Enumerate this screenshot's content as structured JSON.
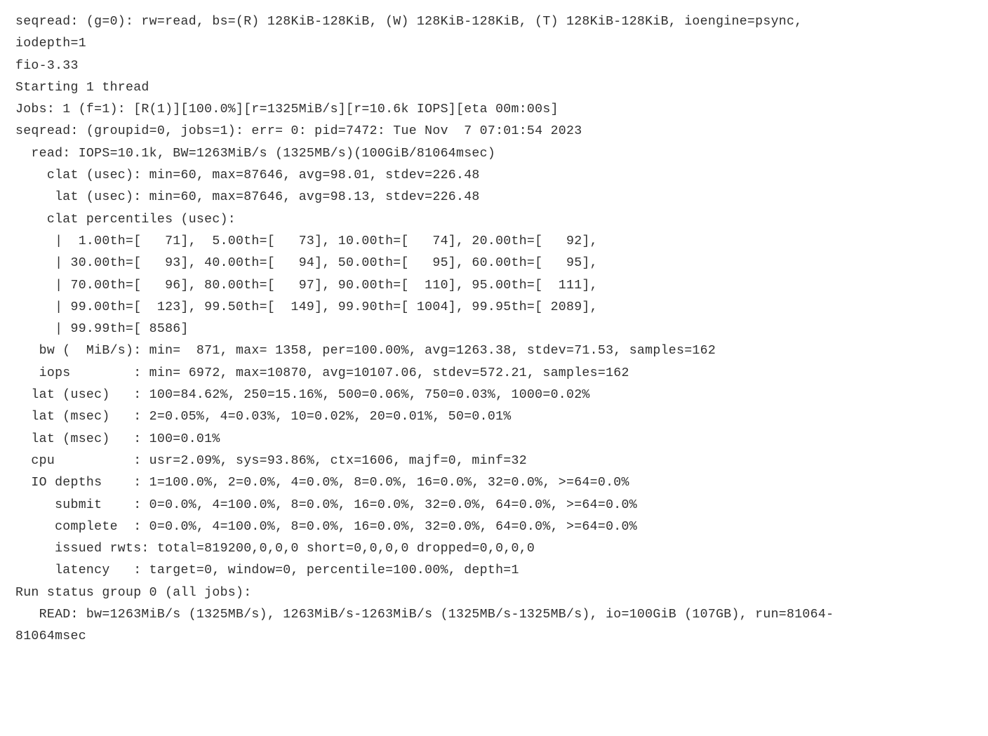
{
  "lines": {
    "l0": "seqread: (g=0): rw=read, bs=(R) 128KiB-128KiB, (W) 128KiB-128KiB, (T) 128KiB-128KiB, ioengine=psync,",
    "l1": "iodepth=1",
    "l2": "fio-3.33",
    "l3": "Starting 1 thread",
    "l4": "Jobs: 1 (f=1): [R(1)][100.0%][r=1325MiB/s][r=10.6k IOPS][eta 00m:00s]",
    "l5": "seqread: (groupid=0, jobs=1): err= 0: pid=7472: Tue Nov  7 07:01:54 2023",
    "l6": "  read: IOPS=10.1k, BW=1263MiB/s (1325MB/s)(100GiB/81064msec)",
    "l7": "    clat (usec): min=60, max=87646, avg=98.01, stdev=226.48",
    "l8": "     lat (usec): min=60, max=87646, avg=98.13, stdev=226.48",
    "l9": "    clat percentiles (usec):",
    "l10": "     |  1.00th=[   71],  5.00th=[   73], 10.00th=[   74], 20.00th=[   92],",
    "l11": "     | 30.00th=[   93], 40.00th=[   94], 50.00th=[   95], 60.00th=[   95],",
    "l12": "     | 70.00th=[   96], 80.00th=[   97], 90.00th=[  110], 95.00th=[  111],",
    "l13": "     | 99.00th=[  123], 99.50th=[  149], 99.90th=[ 1004], 99.95th=[ 2089],",
    "l14": "     | 99.99th=[ 8586]",
    "l15": "   bw (  MiB/s): min=  871, max= 1358, per=100.00%, avg=1263.38, stdev=71.53, samples=162",
    "l16": "   iops        : min= 6972, max=10870, avg=10107.06, stdev=572.21, samples=162",
    "l17": "  lat (usec)   : 100=84.62%, 250=15.16%, 500=0.06%, 750=0.03%, 1000=0.02%",
    "l18": "  lat (msec)   : 2=0.05%, 4=0.03%, 10=0.02%, 20=0.01%, 50=0.01%",
    "l19": "  lat (msec)   : 100=0.01%",
    "l20": "  cpu          : usr=2.09%, sys=93.86%, ctx=1606, majf=0, minf=32",
    "l21": "  IO depths    : 1=100.0%, 2=0.0%, 4=0.0%, 8=0.0%, 16=0.0%, 32=0.0%, >=64=0.0%",
    "l22": "     submit    : 0=0.0%, 4=100.0%, 8=0.0%, 16=0.0%, 32=0.0%, 64=0.0%, >=64=0.0%",
    "l23": "     complete  : 0=0.0%, 4=100.0%, 8=0.0%, 16=0.0%, 32=0.0%, 64=0.0%, >=64=0.0%",
    "l24": "     issued rwts: total=819200,0,0,0 short=0,0,0,0 dropped=0,0,0,0",
    "l25": "     latency   : target=0, window=0, percentile=100.00%, depth=1",
    "l26": "",
    "l27": "Run status group 0 (all jobs):",
    "l28": "   READ: bw=1263MiB/s (1325MB/s), 1263MiB/s-1263MiB/s (1325MB/s-1325MB/s), io=100GiB (107GB), run=81064-",
    "l29": "81064msec"
  }
}
